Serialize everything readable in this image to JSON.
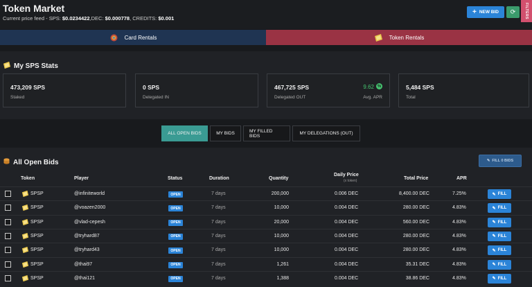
{
  "header": {
    "title": "Token Market",
    "feed_label": "Current price feed - SPS:",
    "sps_price": "$0.0234422",
    "dec_label": ",DEC:",
    "dec_price": "$0.000778",
    "credits_label": ", CREDITS:",
    "credits_price": "$0.001",
    "new_bid_label": "NEW BID",
    "filters_label": "FILTERS"
  },
  "tabs": [
    {
      "label": "Card Rentals",
      "icon": "splinterlands-logo-icon",
      "color": "#1f3452"
    },
    {
      "label": "Token Rentals",
      "icon": "sps-token-icon",
      "color": "#9a3344"
    }
  ],
  "stats": {
    "title": "My SPS Stats",
    "boxes": [
      {
        "value": "473,209 SPS",
        "label": "Staked"
      },
      {
        "value": "0 SPS",
        "label": "Delegated IN"
      },
      {
        "value": "467,725 SPS",
        "label": "Delegated OUT",
        "apr_value": "9.62",
        "apr_label": "Avg. APR"
      },
      {
        "value": "5,484 SPS",
        "label": "Total"
      }
    ]
  },
  "filter_tabs": [
    {
      "label": "ALL OPEN BIDS",
      "active": true
    },
    {
      "label": "MY BIDS",
      "active": false
    },
    {
      "label": "MY FILLED BIDS",
      "active": false
    },
    {
      "label": "MY DELEGATIONS (OUT)",
      "active": false
    }
  ],
  "bids": {
    "title": "All Open Bids",
    "fill_bids_label": "FILL 0 BIDS",
    "columns": {
      "token": "Token",
      "player": "Player",
      "status": "Status",
      "duration": "Duration",
      "quantity": "Quantity",
      "daily_price": "Daily Price",
      "daily_price_sub": "(x token)",
      "total_price": "Total Price",
      "apr": "APR"
    },
    "fill_label": "FILL",
    "rows": [
      {
        "token": "SPSP",
        "player": "@infiniteworld",
        "status": "OPEN",
        "duration": "7 days",
        "quantity": "200,000",
        "daily_price": "0.006 DEC",
        "total_price": "8,400.00 DEC",
        "apr": "7.25%"
      },
      {
        "token": "SPSP",
        "player": "@voazen2000",
        "status": "OPEN",
        "duration": "7 days",
        "quantity": "10,000",
        "daily_price": "0.004 DEC",
        "total_price": "280.00 DEC",
        "apr": "4.83%"
      },
      {
        "token": "SPSP",
        "player": "@vlad-cepesh",
        "status": "OPEN",
        "duration": "7 days",
        "quantity": "20,000",
        "daily_price": "0.004 DEC",
        "total_price": "560.00 DEC",
        "apr": "4.83%"
      },
      {
        "token": "SPSP",
        "player": "@tryhard87",
        "status": "OPEN",
        "duration": "7 days",
        "quantity": "10,000",
        "daily_price": "0.004 DEC",
        "total_price": "280.00 DEC",
        "apr": "4.83%"
      },
      {
        "token": "SPSP",
        "player": "@tryhard43",
        "status": "OPEN",
        "duration": "7 days",
        "quantity": "10,000",
        "daily_price": "0.004 DEC",
        "total_price": "280.00 DEC",
        "apr": "4.83%"
      },
      {
        "token": "SPSP",
        "player": "@thai97",
        "status": "OPEN",
        "duration": "7 days",
        "quantity": "1,261",
        "daily_price": "0.004 DEC",
        "total_price": "35.31 DEC",
        "apr": "4.83%"
      },
      {
        "token": "SPSP",
        "player": "@thai121",
        "status": "OPEN",
        "duration": "7 days",
        "quantity": "1,388",
        "daily_price": "0.004 DEC",
        "total_price": "38.86 DEC",
        "apr": "4.83%"
      }
    ]
  }
}
